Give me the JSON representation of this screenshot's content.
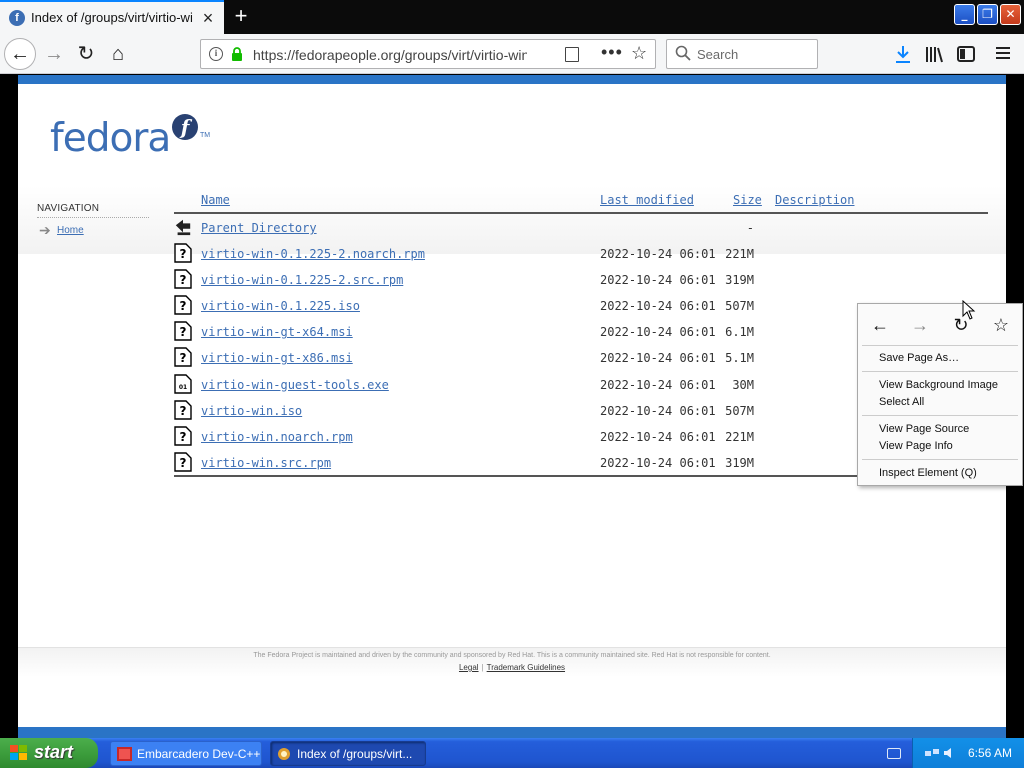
{
  "browser": {
    "tab": {
      "title": "Index of /groups/virt/virtio-win/direct-downloads",
      "favicon_letter": "f"
    },
    "new_tab_label": "+",
    "url": "https://fedorapeople.org/groups/virt/virtio-win/direct-downloads/",
    "search_placeholder": "Search",
    "accent_color": "#0a84ff"
  },
  "page": {
    "logo": {
      "wordmark": "fedora",
      "mark_letter": "f",
      "tm": "TM"
    },
    "navigation": {
      "heading": "NAVIGATION",
      "home_link": "Home"
    },
    "listing": {
      "headers": {
        "name": "Name",
        "last_modified": "Last modified",
        "size": "Size",
        "description": "Description"
      },
      "parent": {
        "name": "Parent Directory",
        "size": "-"
      },
      "files": [
        {
          "name": "virtio-win-0.1.225-2.noarch.rpm",
          "date": "2022-10-24 06:01",
          "size": "221M",
          "icon": "unknown-file-icon"
        },
        {
          "name": "virtio-win-0.1.225-2.src.rpm",
          "date": "2022-10-24 06:01",
          "size": "319M",
          "icon": "unknown-file-icon"
        },
        {
          "name": "virtio-win-0.1.225.iso",
          "date": "2022-10-24 06:01",
          "size": "507M",
          "icon": "unknown-file-icon"
        },
        {
          "name": "virtio-win-gt-x64.msi",
          "date": "2022-10-24 06:01",
          "size": "6.1M",
          "icon": "unknown-file-icon"
        },
        {
          "name": "virtio-win-gt-x86.msi",
          "date": "2022-10-24 06:01",
          "size": "5.1M",
          "icon": "unknown-file-icon"
        },
        {
          "name": "virtio-win-guest-tools.exe",
          "date": "2022-10-24 06:01",
          "size": "30M",
          "icon": "binary-file-icon"
        },
        {
          "name": "virtio-win.iso",
          "date": "2022-10-24 06:01",
          "size": "507M",
          "icon": "unknown-file-icon"
        },
        {
          "name": "virtio-win.noarch.rpm",
          "date": "2022-10-24 06:01",
          "size": "221M",
          "icon": "unknown-file-icon"
        },
        {
          "name": "virtio-win.src.rpm",
          "date": "2022-10-24 06:01",
          "size": "319M",
          "icon": "unknown-file-icon"
        }
      ]
    },
    "footer": {
      "legal_text": "The Fedora Project is maintained and driven by the community and sponsored by Red Hat. This is a community maintained site. Red Hat is not responsible for content.",
      "legal_link": "Legal",
      "trademark_link": "Trademark Guidelines"
    },
    "brand_blue": "#3c6eb4",
    "bar_blue": "#2a74c6"
  },
  "context_menu": {
    "items": {
      "save_page": "Save Page As…",
      "view_bg_image": "View Background Image",
      "select_all": "Select All",
      "view_source": "View Page Source",
      "view_info": "View Page Info",
      "inspect": "Inspect Element (Q)"
    }
  },
  "taskbar": {
    "start_label": "start",
    "tasks": [
      {
        "label": "Embarcadero Dev-C++"
      },
      {
        "label": "Index of /groups/virt..."
      }
    ],
    "clock": "6:56 AM"
  }
}
